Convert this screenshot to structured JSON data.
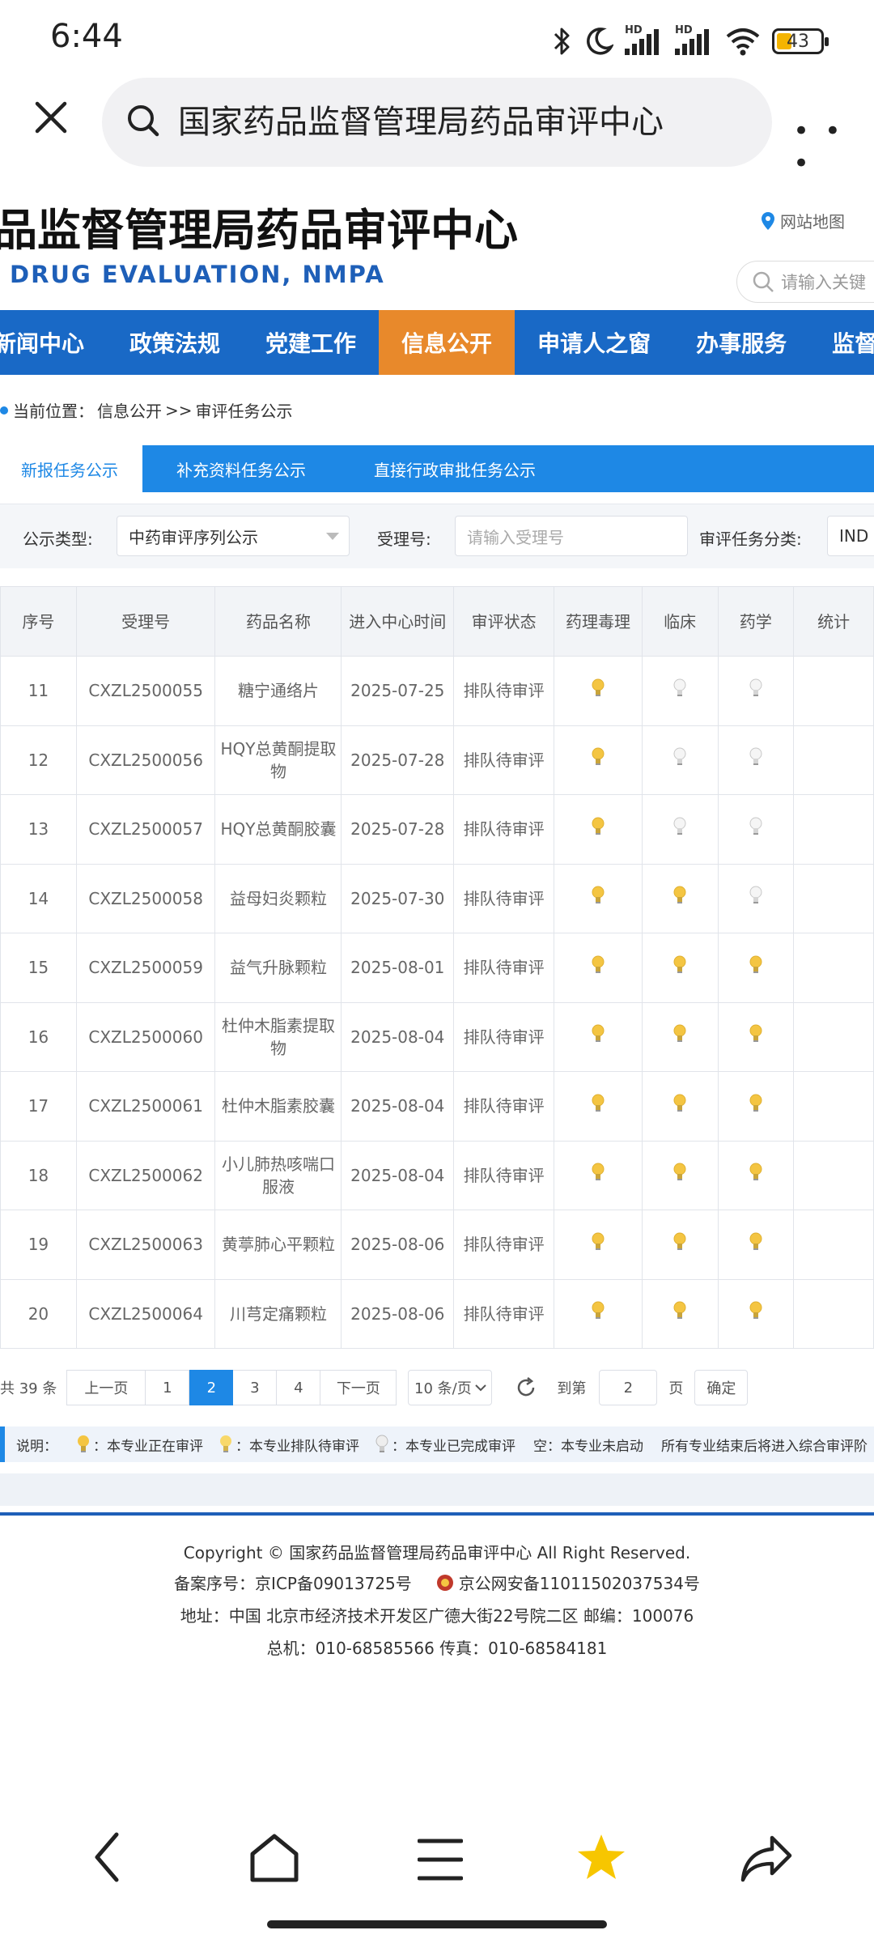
{
  "status_bar": {
    "time": "6:44",
    "battery": "43",
    "hd1": "HD",
    "hd2": "HD"
  },
  "browser": {
    "search_text": "国家药品监督管理局药品审评中心",
    "more": "• • •"
  },
  "site": {
    "title": "品监督管理局药品审评中心",
    "subtitle": "DRUG EVALUATION, NMPA",
    "sitemap": "网站地图",
    "search_placeholder": "请输入关键"
  },
  "nav": {
    "items": [
      "新闻中心",
      "政策法规",
      "党建工作",
      "信息公开",
      "申请人之窗",
      "办事服务",
      "监督"
    ],
    "active_index": 3
  },
  "breadcrumb": {
    "label": "当前位置：",
    "path1": "信息公开",
    "sep": ">>",
    "path2": "审评任务公示"
  },
  "tabs": [
    "新报任务公示",
    "补充资料任务公示",
    "直接行政审批任务公示"
  ],
  "filters": {
    "type_label": "公示类型:",
    "type_value": "中药审评序列公示",
    "accept_label": "受理号:",
    "accept_placeholder": "请输入受理号",
    "category_label": "审评任务分类:",
    "category_value": "IND"
  },
  "table": {
    "headers": [
      "序号",
      "受理号",
      "药品名称",
      "进入中心时间",
      "审评状态",
      "药理毒理",
      "临床",
      "药学",
      "统计"
    ],
    "rows": [
      {
        "no": "11",
        "id": "CXZL2500055",
        "name": "糖宁通络片",
        "date": "2025-07-25",
        "status": "排队待审评",
        "pharm": "on",
        "clin": "off",
        "chem": "off"
      },
      {
        "no": "12",
        "id": "CXZL2500056",
        "name": "HQY总黄酮提取物",
        "date": "2025-07-28",
        "status": "排队待审评",
        "pharm": "on",
        "clin": "off",
        "chem": "off"
      },
      {
        "no": "13",
        "id": "CXZL2500057",
        "name": "HQY总黄酮胶囊",
        "date": "2025-07-28",
        "status": "排队待审评",
        "pharm": "on",
        "clin": "off",
        "chem": "off"
      },
      {
        "no": "14",
        "id": "CXZL2500058",
        "name": "益母妇炎颗粒",
        "date": "2025-07-30",
        "status": "排队待审评",
        "pharm": "on",
        "clin": "on",
        "chem": "off"
      },
      {
        "no": "15",
        "id": "CXZL2500059",
        "name": "益气升脉颗粒",
        "date": "2025-08-01",
        "status": "排队待审评",
        "pharm": "on",
        "clin": "on",
        "chem": "on"
      },
      {
        "no": "16",
        "id": "CXZL2500060",
        "name": "杜仲木脂素提取物",
        "date": "2025-08-04",
        "status": "排队待审评",
        "pharm": "on",
        "clin": "on",
        "chem": "on"
      },
      {
        "no": "17",
        "id": "CXZL2500061",
        "name": "杜仲木脂素胶囊",
        "date": "2025-08-04",
        "status": "排队待审评",
        "pharm": "on",
        "clin": "on",
        "chem": "on"
      },
      {
        "no": "18",
        "id": "CXZL2500062",
        "name": "小儿肺热咳喘口服液",
        "date": "2025-08-04",
        "status": "排队待审评",
        "pharm": "on",
        "clin": "on",
        "chem": "on"
      },
      {
        "no": "19",
        "id": "CXZL2500063",
        "name": "黄葶肺心平颗粒",
        "date": "2025-08-06",
        "status": "排队待审评",
        "pharm": "on",
        "clin": "on",
        "chem": "on"
      },
      {
        "no": "20",
        "id": "CXZL2500064",
        "name": "川芎定痛颗粒",
        "date": "2025-08-06",
        "status": "排队待审评",
        "pharm": "on",
        "clin": "on",
        "chem": "on"
      }
    ]
  },
  "pagination": {
    "total": "共 39 条",
    "prev": "上一页",
    "pages": [
      "1",
      "2",
      "3",
      "4"
    ],
    "current": "2",
    "next": "下一页",
    "page_size": "10 条/页",
    "goto_label": "到第",
    "goto_value": "2",
    "page_unit": "页",
    "confirm": "确定"
  },
  "legend": {
    "label": "说明：",
    "item1": "：本专业正在审评",
    "item2": "：本专业排队待审评",
    "item3": "：本专业已完成审评",
    "item4": "空：本专业未启动",
    "item5": "所有专业结束后将进入综合审评阶"
  },
  "footer": {
    "copyright": "Copyright © 国家药品监督管理局药品审评中心   All Right Reserved.",
    "icp": "备案序号：京ICP备09013725号",
    "police": "京公网安备11011502037534号",
    "address": "地址：中国 北京市经济技术开发区广德大街22号院二区      邮编：100076",
    "phone": "总机：010-68585566      传真：010-68584181"
  },
  "colors": {
    "nav_blue": "#1969c6",
    "tab_blue": "#1e88e5",
    "active_orange": "#e8892b",
    "bulb_on": "#f4c542",
    "bulb_off": "#d9d9d9"
  }
}
